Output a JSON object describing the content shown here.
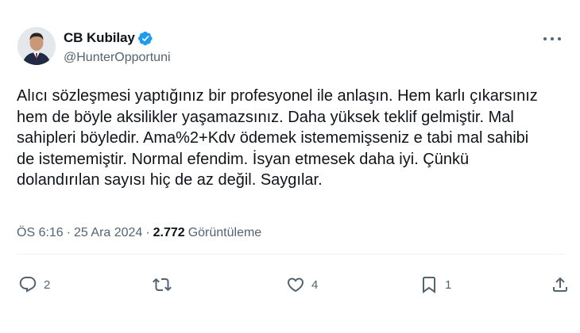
{
  "author": {
    "display_name": "CB Kubilay",
    "handle": "@HunterOpportuni",
    "verified_badge_color": "#1d9bf0"
  },
  "tweet": {
    "lines": [
      "Alıcı sözleşmesi yaptığınız bir profesyonel ile anlaşın. Hem karlı çıkarsınız",
      "hem de böyle aksilikler yaşamazsınız. Daha yüksek teklif gelmiştir. Mal",
      "sahipleri böyledir. Ama%2+Kdv ödemek istememişseniz e tabi mal sahibi",
      "de istememiştir. Normal efendim. İsyan etmesek daha iyi. Çünkü",
      "dolandırılan sayısı hiç de az değil. Saygılar."
    ]
  },
  "meta": {
    "time": "ÖS 6:16",
    "separator": "·",
    "date": "25 Ara 2024",
    "views_count": "2.772",
    "views_label": "Görüntüleme"
  },
  "actions": {
    "reply_count": "2",
    "retweet_count": "",
    "like_count": "4",
    "bookmark_count": "1"
  },
  "icons": {
    "more": "more-horizontal-icon",
    "reply": "reply-icon",
    "retweet": "retweet-icon",
    "like": "heart-icon",
    "bookmark": "bookmark-icon",
    "share": "share-icon",
    "verified": "verified-badge-icon"
  },
  "colors": {
    "text_primary": "#0f1419",
    "text_secondary": "#536471",
    "accent": "#1d9bf0"
  }
}
